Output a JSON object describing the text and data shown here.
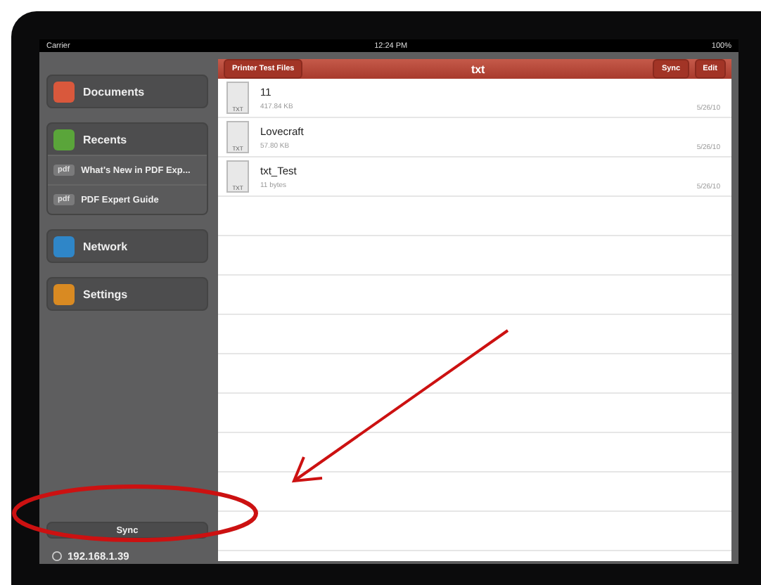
{
  "status_bar": {
    "carrier": "Carrier",
    "time": "12:24 PM",
    "battery": "100%"
  },
  "sidebar": {
    "sections": [
      {
        "label": "Documents",
        "color": "#d9583c"
      },
      {
        "label": "Recents",
        "color": "#5aa53a",
        "files": [
          {
            "badge": "pdf",
            "name": "What's New in PDF Exp..."
          },
          {
            "badge": "pdf",
            "name": "PDF Expert Guide"
          }
        ]
      },
      {
        "label": "Network",
        "color": "#2f86c8"
      },
      {
        "label": "Settings",
        "color": "#d98a22"
      }
    ],
    "sync_button": "Sync",
    "address": "192.168.1.39"
  },
  "content": {
    "back_button": "Printer Test Files",
    "title": "txt",
    "buttons": [
      "Sync",
      "Edit"
    ],
    "files": [
      {
        "type": "TXT",
        "name": "11",
        "size": "417.84 KB",
        "date": "5/26/10"
      },
      {
        "type": "TXT",
        "name": "Lovecraft",
        "size": "57.80 KB",
        "date": "5/26/10"
      },
      {
        "type": "TXT",
        "name": "txt_Test",
        "size": "11 bytes",
        "date": "5/26/10"
      }
    ]
  }
}
